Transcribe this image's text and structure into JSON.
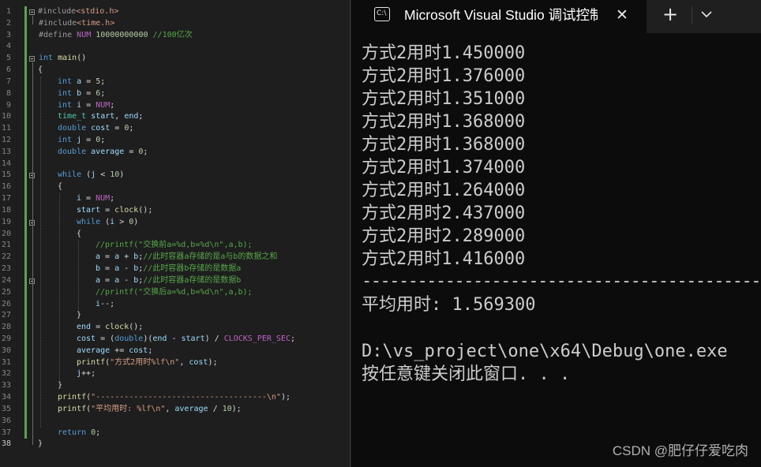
{
  "editor": {
    "line_numbers": [
      "1",
      "2",
      "3",
      "4",
      "5",
      "6",
      "7",
      "8",
      "9",
      "10",
      "11",
      "12",
      "13",
      "14",
      "15",
      "16",
      "17",
      "18",
      "19",
      "20",
      "21",
      "22",
      "23",
      "24",
      "25",
      "26",
      "27",
      "28",
      "29",
      "30",
      "31",
      "32",
      "33",
      "34",
      "35",
      "36",
      "37",
      "38"
    ],
    "current_line": "38",
    "lines": [
      [
        {
          "c": "pp",
          "t": "#include"
        },
        {
          "c": "inc",
          "t": "<stdio.h>"
        }
      ],
      [
        {
          "c": "pp",
          "t": "#include"
        },
        {
          "c": "inc",
          "t": "<time.h>"
        }
      ],
      [
        {
          "c": "pp",
          "t": "#define "
        },
        {
          "c": "m",
          "t": "NUM"
        },
        {
          "c": "",
          "t": " "
        },
        {
          "c": "n",
          "t": "10000000000"
        },
        {
          "c": "",
          "t": " "
        },
        {
          "c": "c",
          "t": "//100亿次"
        }
      ],
      [],
      [
        {
          "c": "k",
          "t": "int"
        },
        {
          "c": "",
          "t": " "
        },
        {
          "c": "f",
          "t": "main"
        },
        {
          "c": "",
          "t": "()"
        }
      ],
      [
        {
          "c": "",
          "t": "{"
        }
      ],
      [
        {
          "c": "k",
          "t": "int"
        },
        {
          "c": "",
          "t": " "
        },
        {
          "c": "v",
          "t": "a"
        },
        {
          "c": "",
          "t": " = "
        },
        {
          "c": "n",
          "t": "5"
        },
        {
          "c": "",
          "t": ";"
        }
      ],
      [
        {
          "c": "k",
          "t": "int"
        },
        {
          "c": "",
          "t": " "
        },
        {
          "c": "v",
          "t": "b"
        },
        {
          "c": "",
          "t": " = "
        },
        {
          "c": "n",
          "t": "6"
        },
        {
          "c": "",
          "t": ";"
        }
      ],
      [
        {
          "c": "k",
          "t": "int"
        },
        {
          "c": "",
          "t": " "
        },
        {
          "c": "v",
          "t": "i"
        },
        {
          "c": "",
          "t": " = "
        },
        {
          "c": "m",
          "t": "NUM"
        },
        {
          "c": "",
          "t": ";"
        }
      ],
      [
        {
          "c": "t",
          "t": "time_t"
        },
        {
          "c": "",
          "t": " "
        },
        {
          "c": "v",
          "t": "start"
        },
        {
          "c": "",
          "t": ", "
        },
        {
          "c": "v",
          "t": "end"
        },
        {
          "c": "",
          "t": ";"
        }
      ],
      [
        {
          "c": "k",
          "t": "double"
        },
        {
          "c": "",
          "t": " "
        },
        {
          "c": "v",
          "t": "cost"
        },
        {
          "c": "",
          "t": " = "
        },
        {
          "c": "n",
          "t": "0"
        },
        {
          "c": "",
          "t": ";"
        }
      ],
      [
        {
          "c": "k",
          "t": "int"
        },
        {
          "c": "",
          "t": " "
        },
        {
          "c": "v",
          "t": "j"
        },
        {
          "c": "",
          "t": " = "
        },
        {
          "c": "n",
          "t": "0"
        },
        {
          "c": "",
          "t": ";"
        }
      ],
      [
        {
          "c": "k",
          "t": "double"
        },
        {
          "c": "",
          "t": " "
        },
        {
          "c": "v",
          "t": "average"
        },
        {
          "c": "",
          "t": " = "
        },
        {
          "c": "n",
          "t": "0"
        },
        {
          "c": "",
          "t": ";"
        }
      ],
      [],
      [
        {
          "c": "k",
          "t": "while"
        },
        {
          "c": "",
          "t": " ("
        },
        {
          "c": "v",
          "t": "j"
        },
        {
          "c": "",
          "t": " < "
        },
        {
          "c": "n",
          "t": "10"
        },
        {
          "c": "",
          "t": ")"
        }
      ],
      [
        {
          "c": "",
          "t": "{"
        }
      ],
      [
        {
          "c": "v",
          "t": "i"
        },
        {
          "c": "",
          "t": " = "
        },
        {
          "c": "m",
          "t": "NUM"
        },
        {
          "c": "",
          "t": ";"
        }
      ],
      [
        {
          "c": "v",
          "t": "start"
        },
        {
          "c": "",
          "t": " = "
        },
        {
          "c": "f",
          "t": "clock"
        },
        {
          "c": "",
          "t": "();"
        }
      ],
      [
        {
          "c": "k",
          "t": "while"
        },
        {
          "c": "",
          "t": " ("
        },
        {
          "c": "v",
          "t": "i"
        },
        {
          "c": "",
          "t": " > "
        },
        {
          "c": "n",
          "t": "0"
        },
        {
          "c": "",
          "t": ")"
        }
      ],
      [
        {
          "c": "",
          "t": "{"
        }
      ],
      [
        {
          "c": "c",
          "t": "//printf(\"交换前a=%d,b=%d\\n\",a,b);"
        }
      ],
      [
        {
          "c": "v",
          "t": "a"
        },
        {
          "c": "",
          "t": " = "
        },
        {
          "c": "v",
          "t": "a"
        },
        {
          "c": "",
          "t": " + "
        },
        {
          "c": "v",
          "t": "b"
        },
        {
          "c": "",
          "t": ";"
        },
        {
          "c": "c",
          "t": "//此时容器a存储的是a与b的数据之和"
        }
      ],
      [
        {
          "c": "v",
          "t": "b"
        },
        {
          "c": "",
          "t": " = "
        },
        {
          "c": "v",
          "t": "a"
        },
        {
          "c": "",
          "t": " - "
        },
        {
          "c": "v",
          "t": "b"
        },
        {
          "c": "",
          "t": ";"
        },
        {
          "c": "c",
          "t": "//此时容器b存储的是数据a"
        }
      ],
      [
        {
          "c": "v",
          "t": "a"
        },
        {
          "c": "",
          "t": " = "
        },
        {
          "c": "v",
          "t": "a"
        },
        {
          "c": "",
          "t": " - "
        },
        {
          "c": "v",
          "t": "b"
        },
        {
          "c": "",
          "t": ";"
        },
        {
          "c": "c",
          "t": "//此时容器a存储的是数据b"
        }
      ],
      [
        {
          "c": "c",
          "t": "//printf(\"交换后a=%d,b=%d\\n\",a,b);"
        }
      ],
      [
        {
          "c": "v",
          "t": "i"
        },
        {
          "c": "",
          "t": "--;"
        }
      ],
      [
        {
          "c": "",
          "t": "}"
        }
      ],
      [
        {
          "c": "v",
          "t": "end"
        },
        {
          "c": "",
          "t": " = "
        },
        {
          "c": "f",
          "t": "clock"
        },
        {
          "c": "",
          "t": "();"
        }
      ],
      [
        {
          "c": "v",
          "t": "cost"
        },
        {
          "c": "",
          "t": " = ("
        },
        {
          "c": "k",
          "t": "double"
        },
        {
          "c": "",
          "t": ")("
        },
        {
          "c": "v",
          "t": "end"
        },
        {
          "c": "",
          "t": " - "
        },
        {
          "c": "v",
          "t": "start"
        },
        {
          "c": "",
          "t": ") / "
        },
        {
          "c": "m",
          "t": "CLOCKS_PER_SEC"
        },
        {
          "c": "",
          "t": ";"
        }
      ],
      [
        {
          "c": "v",
          "t": "average"
        },
        {
          "c": "",
          "t": " += "
        },
        {
          "c": "v",
          "t": "cost"
        },
        {
          "c": "",
          "t": ";"
        }
      ],
      [
        {
          "c": "f",
          "t": "printf"
        },
        {
          "c": "",
          "t": "("
        },
        {
          "c": "s",
          "t": "\"方式2用时%lf\\n\""
        },
        {
          "c": "",
          "t": ", "
        },
        {
          "c": "v",
          "t": "cost"
        },
        {
          "c": "",
          "t": ");"
        }
      ],
      [
        {
          "c": "v",
          "t": "j"
        },
        {
          "c": "",
          "t": "++;"
        }
      ],
      [
        {
          "c": "",
          "t": "}"
        }
      ],
      [
        {
          "c": "f",
          "t": "printf"
        },
        {
          "c": "",
          "t": "("
        },
        {
          "c": "s",
          "t": "\"------------------------------------\\n\""
        },
        {
          "c": "",
          "t": ");"
        }
      ],
      [
        {
          "c": "f",
          "t": "printf"
        },
        {
          "c": "",
          "t": "("
        },
        {
          "c": "s",
          "t": "\"平均用时: %lf\\n\""
        },
        {
          "c": "",
          "t": ", "
        },
        {
          "c": "v",
          "t": "average"
        },
        {
          "c": "",
          "t": " / "
        },
        {
          "c": "n",
          "t": "10"
        },
        {
          "c": "",
          "t": ");"
        }
      ],
      [],
      [
        {
          "c": "k",
          "t": "return"
        },
        {
          "c": "",
          "t": " "
        },
        {
          "c": "n",
          "t": "0"
        },
        {
          "c": "",
          "t": ";"
        }
      ],
      [
        {
          "c": "",
          "t": "}"
        }
      ]
    ],
    "indent_levels": [
      0,
      0,
      0,
      0,
      0,
      0,
      1,
      1,
      1,
      1,
      1,
      1,
      1,
      0,
      1,
      1,
      2,
      2,
      2,
      2,
      3,
      3,
      3,
      3,
      3,
      3,
      2,
      2,
      2,
      2,
      2,
      2,
      1,
      1,
      1,
      0,
      1,
      0
    ],
    "colors": {
      "keyword": "#569cd6",
      "type": "#4ec9b0",
      "function": "#dcdcaa",
      "string": "#d69d85",
      "comment": "#57a64a",
      "number": "#b5cea8",
      "macro": "#bd63c5",
      "variable": "#9cdcfe"
    }
  },
  "terminal": {
    "tab_title": "Microsoft Visual Studio 调试控制台",
    "tab_icon_text": "C:\\",
    "close_glyph": "✕",
    "new_tab_glyph": "+",
    "output_lines": [
      "方式2用时1.450000",
      "方式2用时1.376000",
      "方式2用时1.351000",
      "方式2用时1.368000",
      "方式2用时1.368000",
      "方式2用时1.374000",
      "方式2用时1.264000",
      "方式2用时2.437000",
      "方式2用时2.289000",
      "方式2用时1.416000"
    ],
    "separator": "----------------------------------------------------",
    "average_line": "平均用时: 1.569300",
    "exe_path": "D:\\vs_project\\one\\x64\\Debug\\one.exe",
    "close_prompt": "按任意键关闭此窗口. . ."
  },
  "watermark": "CSDN @肥仔仔爱吃肉"
}
